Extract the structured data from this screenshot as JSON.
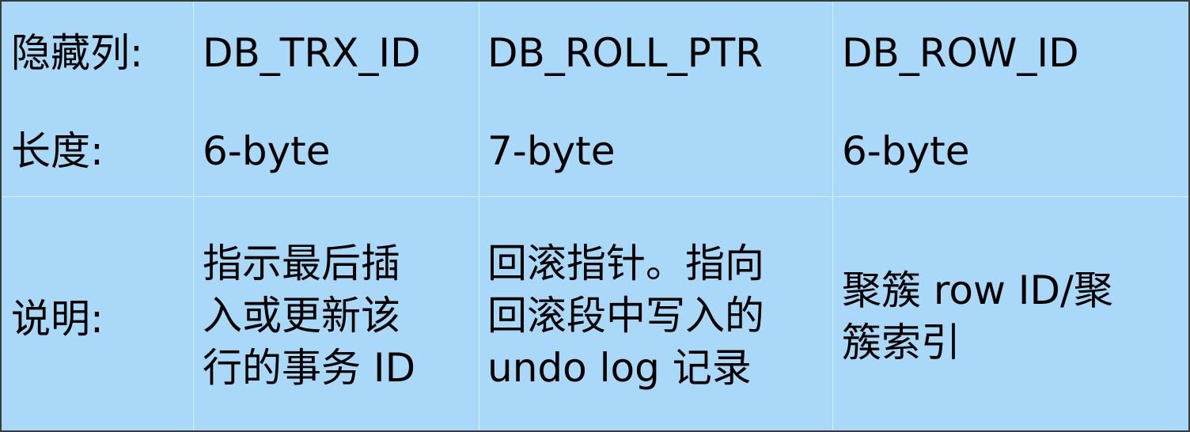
{
  "table": {
    "row_labels": {
      "hidden_columns": "隐藏列:",
      "length": "长度:",
      "description": "说明:"
    },
    "columns": [
      {
        "name": "DB_TRX_ID",
        "length": "6-byte",
        "description": "指示最后插\n入或更新该\n行的事务 ID"
      },
      {
        "name": "DB_ROLL_PTR",
        "length": "7-byte",
        "description": "回滚指针。指向\n回滚段中写入的\nundo log 记录"
      },
      {
        "name": "DB_ROW_ID",
        "length": "6-byte",
        "description": "聚簇 row ID/聚\n簇索引"
      }
    ]
  },
  "colors": {
    "background": "#a9d8f8",
    "grid": "#d9eefc",
    "text": "#000000"
  }
}
